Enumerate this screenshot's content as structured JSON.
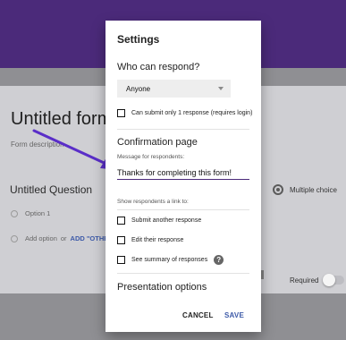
{
  "background": {
    "form_title": "Untitled form",
    "form_description": "Form description",
    "question_title": "Untitled Question",
    "options": [
      {
        "label": "Option 1"
      }
    ],
    "add_option_prefix": "Add option",
    "add_option_or": "or",
    "add_other_label": "ADD \"OTHER\"",
    "question_type": "Multiple choice",
    "required_label": "Required"
  },
  "dialog": {
    "title": "Settings",
    "who_can_respond": {
      "heading": "Who can respond?",
      "dropdown_value": "Anyone",
      "limit_one_response": "Can submit only 1 response (requires login)"
    },
    "confirmation_page": {
      "heading": "Confirmation page",
      "message_label": "Message for respondents:",
      "message_value": "Thanks for completing this form!",
      "link_label": "Show respondents a link to:",
      "links": [
        {
          "label": "Submit another response"
        },
        {
          "label": "Edit their response"
        },
        {
          "label": "See summary of responses"
        }
      ],
      "help_glyph": "?"
    },
    "presentation_options_heading": "Presentation options",
    "buttons": {
      "cancel": "CANCEL",
      "save": "SAVE"
    }
  },
  "colors": {
    "header_purple": "#4b2a7a",
    "accent_blue": "#3d5aa8",
    "arrow_purple": "#5a2ec8"
  }
}
